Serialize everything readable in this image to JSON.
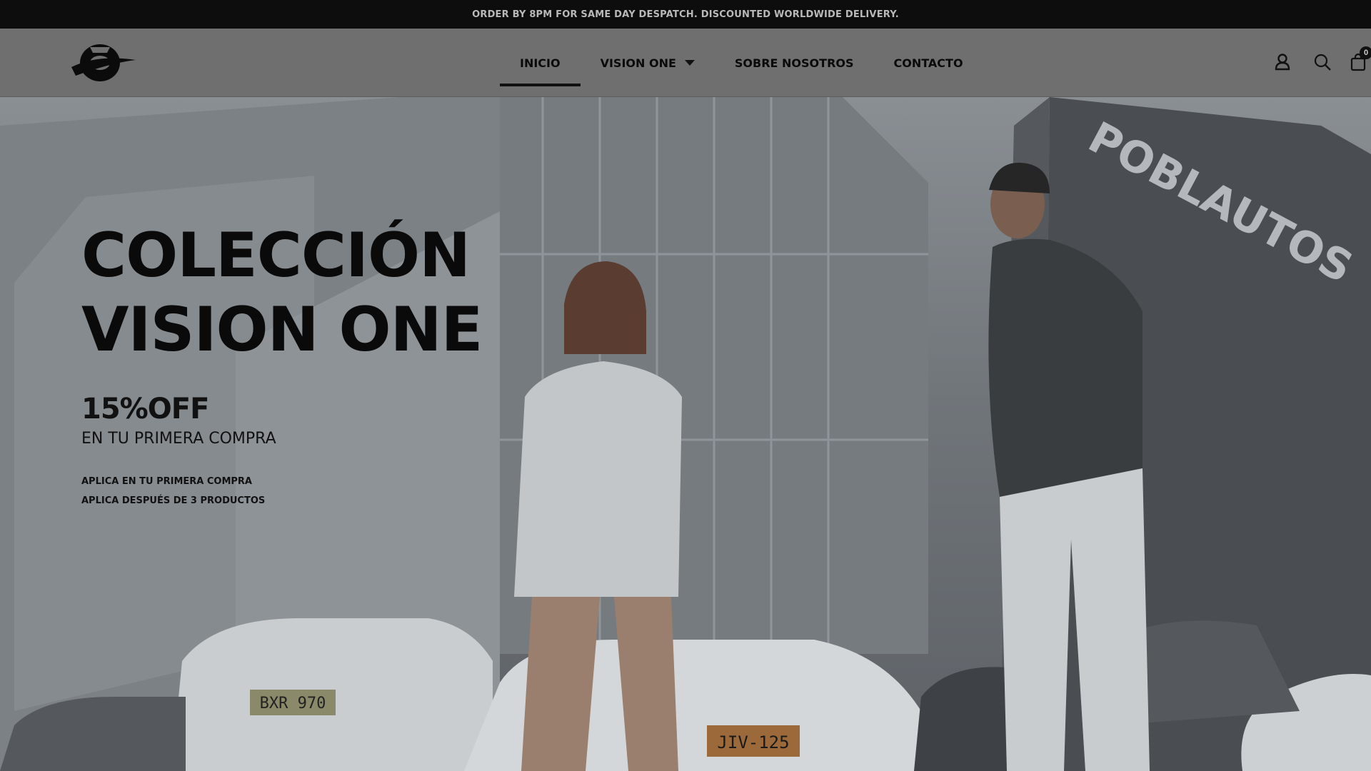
{
  "announcement": "ORDER BY 8PM FOR SAME DAY DESPATCH. DISCOUNTED WORLDWIDE DELIVERY.",
  "header": {
    "logo_icon": "brand-logo-icon",
    "nav": [
      {
        "label": "INICIO",
        "active": true
      },
      {
        "label": "VISION ONE",
        "has_dropdown": true
      },
      {
        "label": "SOBRE NOSOTROS"
      },
      {
        "label": "CONTACTO"
      }
    ],
    "icons": [
      "user-icon",
      "search-icon",
      "cart-icon"
    ],
    "cart_count": "0"
  },
  "hero": {
    "title_line1": "COLECCIÓN",
    "title_line2": "VISION ONE",
    "offer": "15%OFF",
    "subtitle": "EN TU PRIMERA COMPRA",
    "note1": "APLICA EN TU PRIMERA COMPRA",
    "note2": "APLICA DESPUÉS DE 3 PRODUCTOS",
    "building_sign": "POBLAUTOS",
    "plates": [
      "BXR 970",
      "JIV-125"
    ]
  },
  "colors": {
    "announcement_bg": "#0d0d0d",
    "header_bg": "#6f6f6f",
    "text_dark": "#0a0a0a"
  }
}
